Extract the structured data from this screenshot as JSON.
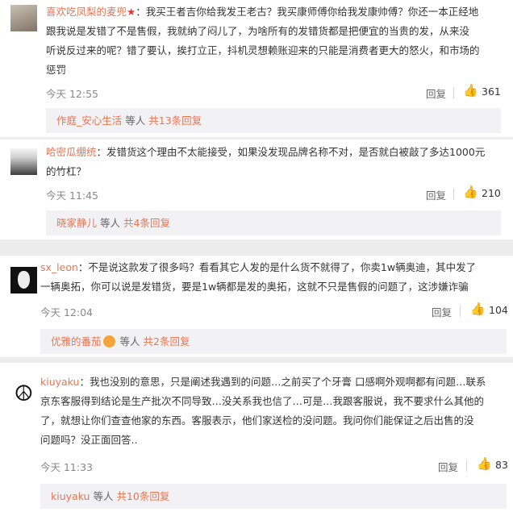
{
  "comments": [
    {
      "user": "喜欢吃凤梨的麦兜",
      "lines": [
        "：我买王者吉你给我发王老古？我买康师傅你给我发康帅傅？你还一本正经地",
        "跟我说是发错了不是售假，我就纳了闷儿了，为啥所有的发错货都是把便宜的当贵的发，从来没",
        "听说反过来的呢？错了要认，挨打立正，抖机灵想赖账迎来的只能是消费者更大的怒火，和市场的",
        "惩罚"
      ],
      "time": "今天 12:55",
      "reply": "回复",
      "likes": "361",
      "sub_name": "作庭_安心生活",
      "sub_mid": "等人",
      "sub_total": "共13条回复"
    },
    {
      "user": "哈密瓜绷统",
      "lines": [
        "：发错货这个理由不太能接受，如果没发现品牌名称不对，是否就白被敲了多达1000元",
        "的竹杠？"
      ],
      "time": "今天 11:45",
      "reply": "回复",
      "likes": "210",
      "sub_name": "晓家静儿",
      "sub_mid": "等人",
      "sub_total": "共4条回复"
    },
    {
      "user": "sx_leon",
      "lines": [
        "：不是说这款发了很多吗？看看其它人发的是什么货不就得了，你卖1w辆奥迪，其中发了",
        "一辆奥拓，你可以说是发错货，要是1w辆都是发的奥拓，这就不只是售假的问题了，这涉嫌诈骗"
      ],
      "time": "今天 12:04",
      "reply": "回复",
      "likes": "104",
      "sub_name": "优雅的番茄",
      "sub_mid": "等人",
      "sub_total": "共2条回复"
    },
    {
      "user": "kiuyaku",
      "lines": [
        "：我也没别的意思，只是阐述我遇到的问题…之前买了个牙膏 口感啊外观啊都有问题…联系",
        "京东客服得到结论是生产批次不同导致…没关系我也信了…可是…我跟客服说，我不要求什么其他的",
        "了，就想让你们查查他家的东西。客服表示，他们家送检的没问题。我问你们能保证之后出售的没",
        "问题吗？没正面回答.."
      ],
      "time": "今天 11:33",
      "reply": "回复",
      "likes": "83",
      "sub_name": "kiuyaku",
      "sub_mid": "等人",
      "sub_total": "共10条回复"
    }
  ],
  "icons": {
    "like": "thumb-up-icon",
    "star": "star-icon",
    "emoji": "emoji-icon",
    "peace": "peace-sign-icon"
  },
  "colors": {
    "username": "#eb7350",
    "background": "#ececec",
    "subbar": "#f2f2f5"
  }
}
